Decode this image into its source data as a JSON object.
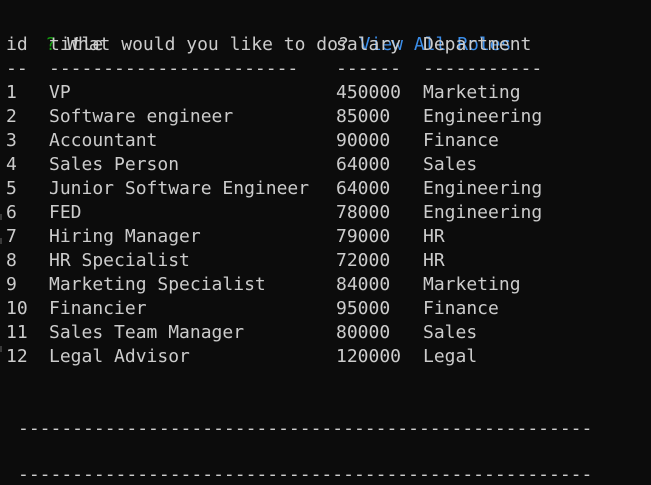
{
  "prompt": {
    "marker": "?",
    "question": "What would you like to do?",
    "answer": "View All Roles"
  },
  "table": {
    "headers": {
      "id": "id",
      "title": "title",
      "salary": "salary",
      "department": "Department"
    },
    "underline": {
      "id": "--",
      "title": "-----------------------",
      "salary": "------",
      "department": "-----------"
    },
    "rows": [
      {
        "id": "1",
        "title": "VP",
        "salary": "450000",
        "department": "Marketing"
      },
      {
        "id": "2",
        "title": "Software engineer",
        "salary": "85000",
        "department": "Engineering"
      },
      {
        "id": "3",
        "title": "Accountant",
        "salary": "90000",
        "department": "Finance"
      },
      {
        "id": "4",
        "title": "Sales Person",
        "salary": "64000",
        "department": "Sales"
      },
      {
        "id": "5",
        "title": "Junior Software Engineer",
        "salary": "64000",
        "department": "Engineering"
      },
      {
        "id": "6",
        "title": "FED",
        "salary": "78000",
        "department": "Engineering"
      },
      {
        "id": "7",
        "title": "Hiring Manager",
        "salary": "79000",
        "department": "HR"
      },
      {
        "id": "8",
        "title": "HR Specialist",
        "salary": "72000",
        "department": "HR"
      },
      {
        "id": "9",
        "title": "Marketing Specialist",
        "salary": "84000",
        "department": "Marketing"
      },
      {
        "id": "10",
        "title": "Financier",
        "salary": "95000",
        "department": "Finance"
      },
      {
        "id": "11",
        "title": "Sales Team Manager",
        "salary": "80000",
        "department": "Sales"
      },
      {
        "id": "12",
        "title": "Legal Advisor",
        "salary": "120000",
        "department": "Legal"
      }
    ]
  },
  "separators": [
    "-----------------------------------------------------",
    "-----------------------------------------------------"
  ],
  "colors": {
    "background": "#0c0c0c",
    "text": "#cccccc",
    "prompt_marker": "#13a10e",
    "answer": "#3b8eea"
  }
}
